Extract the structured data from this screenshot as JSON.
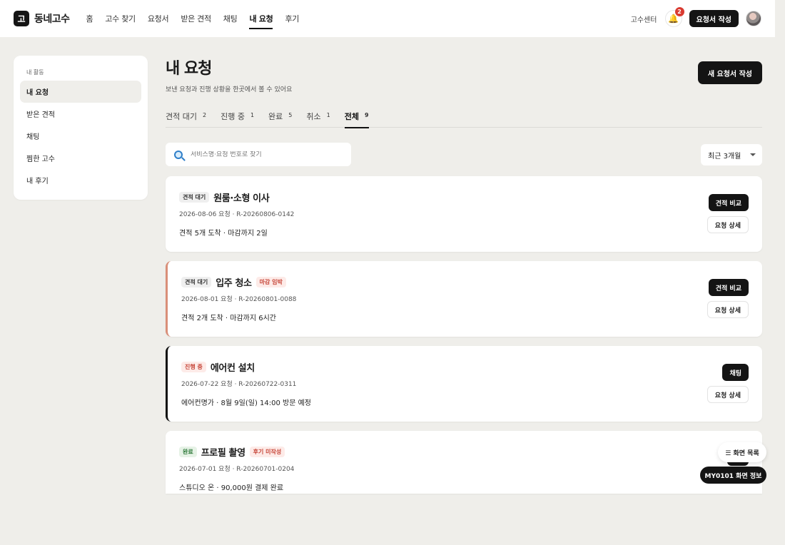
{
  "header": {
    "logo_mark": "고",
    "logo_text": "동네고수",
    "nav": [
      "홈",
      "고수 찾기",
      "요청서",
      "받은 견적",
      "채팅",
      "내 요청",
      "후기"
    ],
    "help_label": "고수센터",
    "notification_count": "2",
    "write_label": "요청서 작성"
  },
  "sidebar": {
    "title": "내 활동",
    "items": [
      "내 요청",
      "받은 견적",
      "채팅",
      "찜한 고수",
      "내 후기"
    ]
  },
  "main": {
    "title": "내 요청",
    "subtitle": "보낸 요청과 진행 상황을 한곳에서 볼 수 있어요",
    "new_button": "새 요청서 작성",
    "tabs": [
      {
        "label": "견적 대기",
        "count": "2"
      },
      {
        "label": "진행 중",
        "count": "1"
      },
      {
        "label": "완료",
        "count": "5"
      },
      {
        "label": "취소",
        "count": "1"
      },
      {
        "label": "전체",
        "count": "9"
      }
    ],
    "search_placeholder": "서비스명·요청 번호로 찾기",
    "period": "최근 3개월"
  },
  "cards": [
    {
      "status": "견적 대기",
      "title": "원룸·소형 이사",
      "meta": "2026-08-06 요청 · R-20260806-0142",
      "desc": "견적 5개 도착 · 마감까지 2일",
      "primary": "견적 비교",
      "secondary": "요청 상세"
    },
    {
      "status": "견적 대기",
      "title": "입주 청소",
      "extra_tag": "마감 임박",
      "meta": "2026-08-01 요청 · R-20260801-0088",
      "desc": "견적 2개 도착 · 마감까지 6시간",
      "primary": "견적 비교",
      "secondary": "요청 상세"
    },
    {
      "status": "진행 중",
      "title": "에어컨 설치",
      "meta": "2026-07-22 요청 · R-20260722-0311",
      "desc": "에어컨명가 · 8월 9일(일) 14:00 방문 예정",
      "primary": "채팅",
      "secondary": "요청 상세"
    },
    {
      "status": "완료",
      "title": "프로필 촬영",
      "extra_tag": "후기 미작성",
      "meta": "2026-07-01 요청 · R-20260701-0204",
      "desc": "스튜디오 온 · 90,000원 결제 완료"
    }
  ],
  "floating": {
    "list_label": "☰ 화면 목록",
    "info_label": "MY0101 화면 정보"
  }
}
